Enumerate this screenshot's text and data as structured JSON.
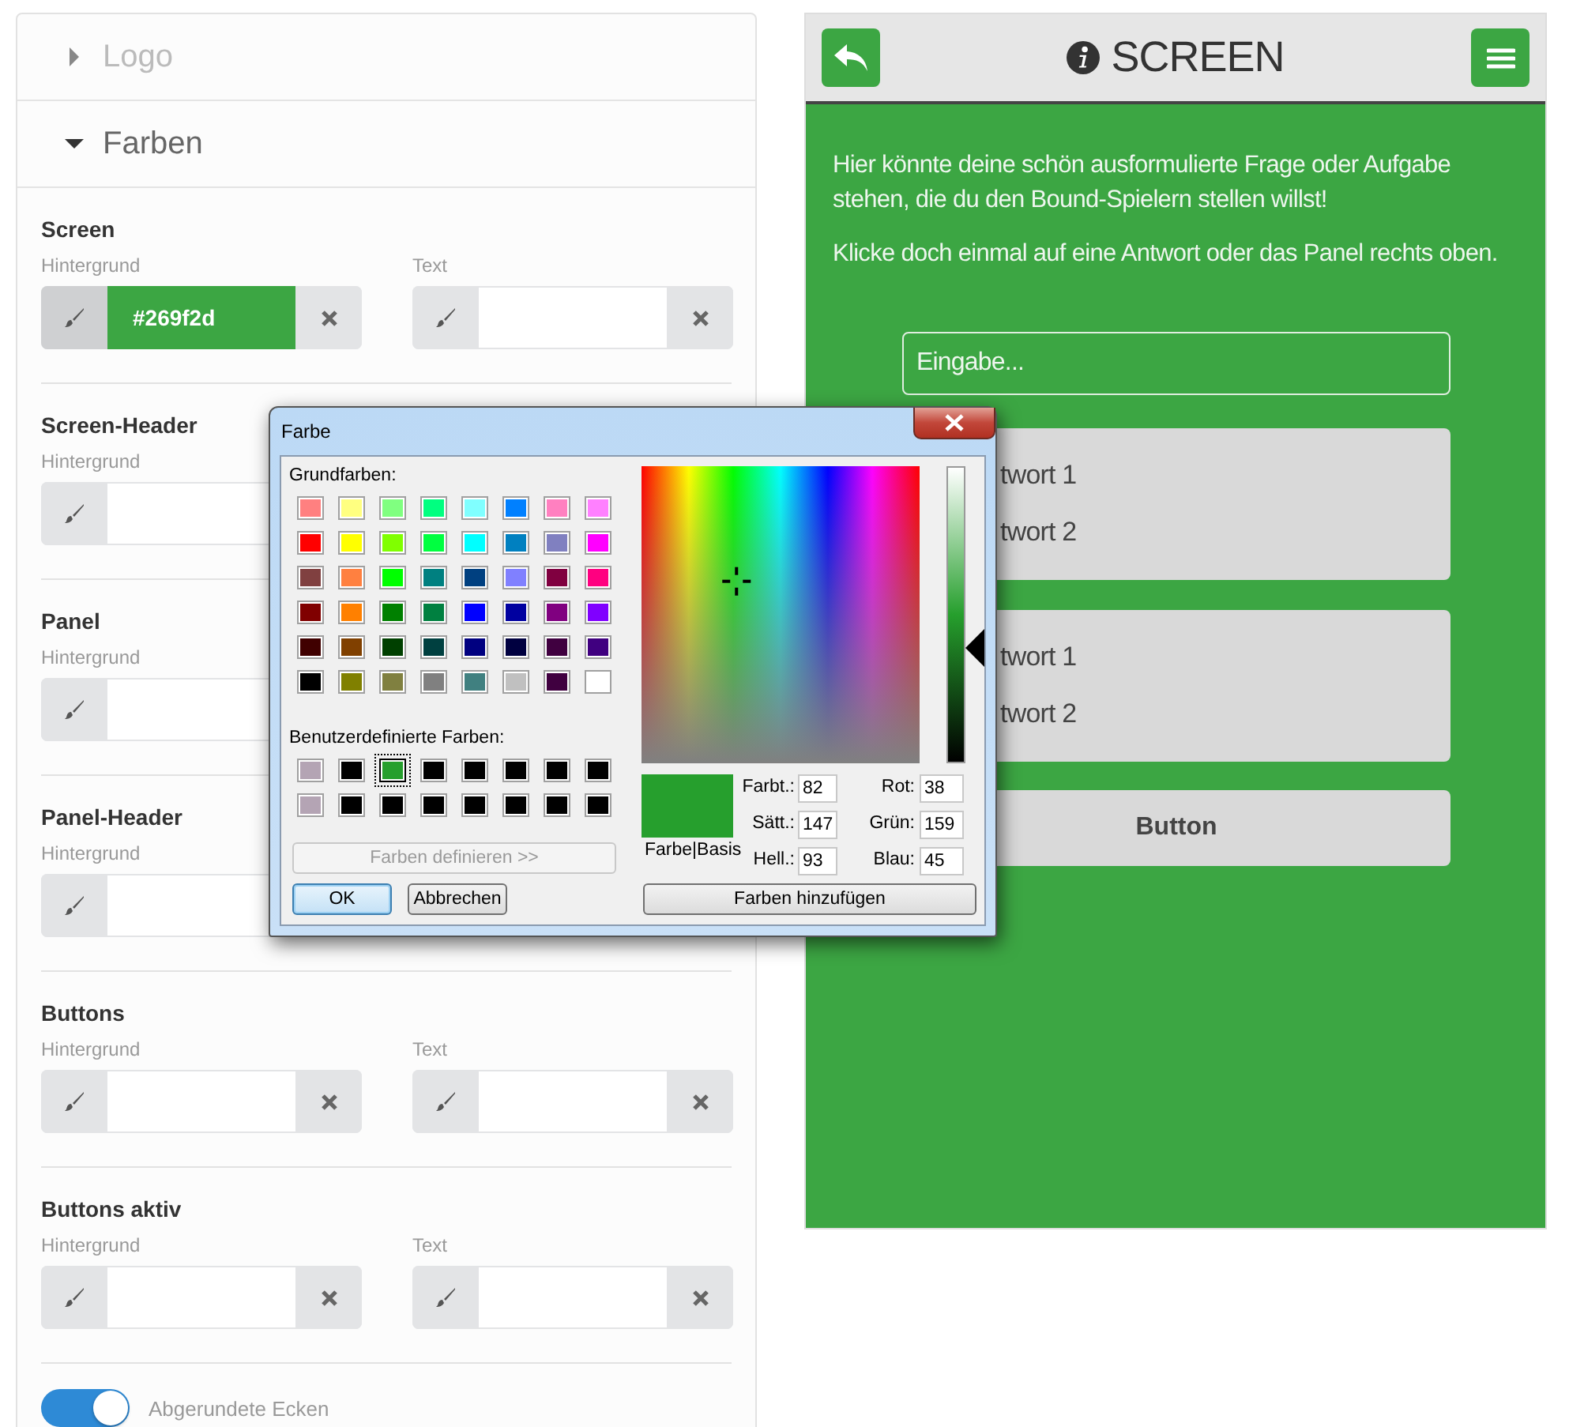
{
  "settings": {
    "accordion": [
      {
        "label": "Logo",
        "expanded": false
      },
      {
        "label": "Farben",
        "expanded": true,
        "sections": [
          {
            "title": "Screen",
            "fields": [
              {
                "label": "Hintergrund",
                "value": "#269f2d",
                "color": "#3ca643"
              },
              {
                "label": "Text"
              }
            ]
          },
          {
            "title": "Screen-Header",
            "fields": [
              {
                "label": "Hintergrund"
              }
            ]
          },
          {
            "title": "Panel",
            "fields": [
              {
                "label": "Hintergrund"
              }
            ]
          },
          {
            "title": "Panel-Header",
            "fields": [
              {
                "label": "Hintergrund"
              }
            ]
          },
          {
            "title": "Buttons",
            "fields": [
              {
                "label": "Hintergrund"
              },
              {
                "label": "Text"
              }
            ]
          },
          {
            "title": "Buttons aktiv",
            "fields": [
              {
                "label": "Hintergrund"
              },
              {
                "label": "Text"
              }
            ]
          }
        ],
        "toggle": {
          "label": "Abgerundete Ecken",
          "on": true
        }
      }
    ]
  },
  "preview": {
    "title": "SCREEN",
    "question": [
      "Hier könnte deine schön ausformulierte Frage oder Aufgabe stehen, die du den Bound-Spielern stellen willst!",
      "Klicke doch einmal auf eine Antwort oder das Panel rechts oben."
    ],
    "input": {
      "placeholder": "Eingabe..."
    },
    "answer_groups": [
      [
        "twort 1",
        "twort 2"
      ],
      [
        "twort 1",
        "twort 2"
      ]
    ],
    "button": "Button"
  },
  "dialog": {
    "title": "Farbe",
    "basic_label": "Grundfarben:",
    "basic_colors": [
      {
        "color": "#ff8080"
      },
      {
        "color": "#ffff80"
      },
      {
        "color": "#80ff80"
      },
      {
        "color": "#00ff80"
      },
      {
        "color": "#80ffff"
      },
      {
        "color": "#0080ff"
      },
      {
        "color": "#ff80c0"
      },
      {
        "color": "#ff80ff"
      },
      {
        "color": "#ff0000"
      },
      {
        "color": "#ffff00"
      },
      {
        "color": "#80ff00"
      },
      {
        "color": "#00ff40"
      },
      {
        "color": "#00ffff"
      },
      {
        "color": "#0080c0"
      },
      {
        "color": "#8080c0"
      },
      {
        "color": "#ff00ff"
      },
      {
        "color": "#804040"
      },
      {
        "color": "#ff8040"
      },
      {
        "color": "#00ff00"
      },
      {
        "color": "#008080"
      },
      {
        "color": "#004080"
      },
      {
        "color": "#8080ff"
      },
      {
        "color": "#800040"
      },
      {
        "color": "#ff0080"
      },
      {
        "color": "#800000"
      },
      {
        "color": "#ff8000"
      },
      {
        "color": "#008000"
      },
      {
        "color": "#008040"
      },
      {
        "color": "#0000ff"
      },
      {
        "color": "#0000a0"
      },
      {
        "color": "#800080"
      },
      {
        "color": "#8000ff"
      },
      {
        "color": "#400000"
      },
      {
        "color": "#804000"
      },
      {
        "color": "#004000"
      },
      {
        "color": "#004040"
      },
      {
        "color": "#000080"
      },
      {
        "color": "#000040"
      },
      {
        "color": "#400040"
      },
      {
        "color": "#400080"
      },
      {
        "color": "#000000"
      },
      {
        "color": "#808000"
      },
      {
        "color": "#808040"
      },
      {
        "color": "#808080"
      },
      {
        "color": "#408080"
      },
      {
        "color": "#c0c0c0"
      },
      {
        "color": "#400040"
      },
      {
        "color": "#ffffff"
      }
    ],
    "custom_label": "Benutzerdefinierte Farben:",
    "custom_colors": [
      {
        "color": "#b4a4b4",
        "selected": false
      },
      {
        "color": "#000000",
        "selected": false
      },
      {
        "color": "#269f2d",
        "selected": true
      },
      {
        "color": "#000000",
        "selected": false
      },
      {
        "color": "#000000",
        "selected": false
      },
      {
        "color": "#000000",
        "selected": false
      },
      {
        "color": "#000000",
        "selected": false
      },
      {
        "color": "#000000",
        "selected": false
      },
      {
        "color": "#b4a4b4",
        "selected": false
      },
      {
        "color": "#000000",
        "selected": false
      },
      {
        "color": "#000000",
        "selected": false
      },
      {
        "color": "#000000",
        "selected": false
      },
      {
        "color": "#000000",
        "selected": false
      },
      {
        "color": "#000000",
        "selected": false
      },
      {
        "color": "#000000",
        "selected": false
      },
      {
        "color": "#000000",
        "selected": false
      }
    ],
    "define_button": {
      "label": "Farben definieren >>",
      "disabled": true
    },
    "ok": "OK",
    "cancel": "Abbrechen",
    "preview_label": "Farbe|Basis",
    "luminance": {
      "level": 0.39
    },
    "values_left": [
      {
        "label": "Farbt.:",
        "value": "82"
      },
      {
        "label": "Sätt.:",
        "value": "147"
      },
      {
        "label": "Hell.:",
        "value": "93"
      }
    ],
    "values_right": [
      {
        "label": "Rot:",
        "value": "38"
      },
      {
        "label": "Grün:",
        "value": "159"
      },
      {
        "label": "Blau:",
        "value": "45"
      }
    ],
    "add_button": "Farben hinzufügen"
  }
}
